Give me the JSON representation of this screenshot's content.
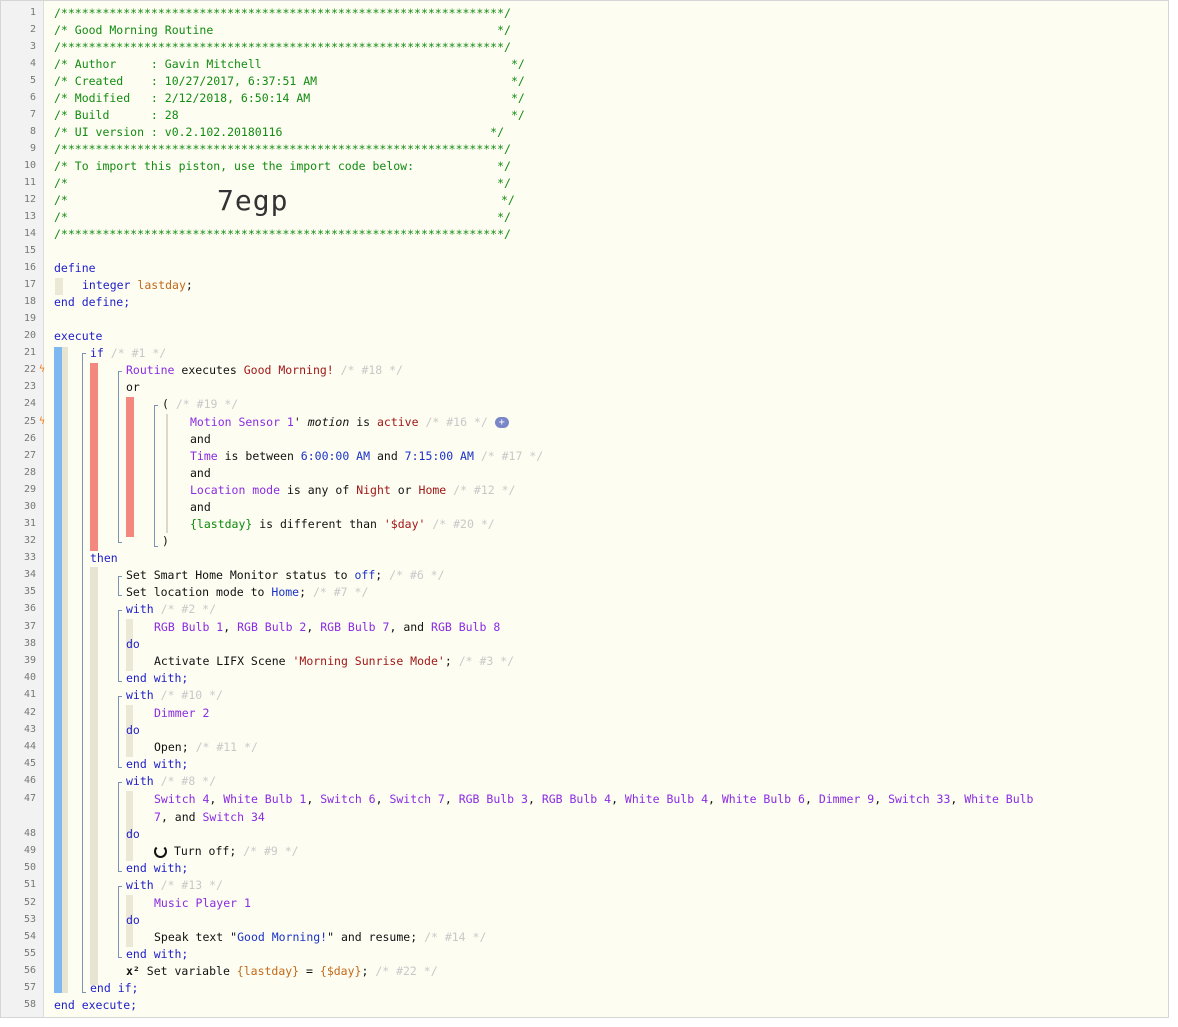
{
  "header": {
    "stars": "/****************************************************************/",
    "title": "/* Good Morning Routine                                         */",
    "author": "/* Author     : Gavin Mitchell                                    */",
    "created": "/* Created    : 10/27/2017, 6:37:51 AM                            */",
    "modified": "/* Modified   : 2/12/2018, 6:50:14 AM                             */",
    "build": "/* Build      : 28                                                */",
    "ui_version": "/* UI version : v0.2.102.20180116                              */",
    "import_line": "/* To import this piston, use the import code below:            */",
    "blank_a": "/*                                                              */",
    "code_prefix": "/*",
    "code_suffix": "*/",
    "import_code": "7egp"
  },
  "lines": {
    "l16": "define",
    "l17_type": "integer",
    "l17_name": "lastday",
    "l18": "end define;",
    "l20": "execute",
    "l21_if": "if",
    "l21_c": "/* #1 */",
    "l22_a": "Routine",
    "l22_b": " executes ",
    "l22_c": "Good Morning!",
    "l22_d": "/* #18 */",
    "l23": "or",
    "l24_p": "(",
    "l24_c": "/* #19 */",
    "l25_dev": "Motion Sensor 1",
    "l25_q": "'",
    "l25_attr": "motion",
    "l25_is": " is ",
    "l25_val": "active",
    "l25_c": "/* #16 */",
    "l26": "and",
    "l27_a": "Time",
    "l27_b": " is between ",
    "l27_c": "6:00:00 AM",
    "l27_d": " and ",
    "l27_e": "7:15:00 AM",
    "l27_f": "/* #17 */",
    "l28": "and",
    "l29_a": "Location mode",
    "l29_b": " is any of ",
    "l29_c": "Night",
    "l29_d": " or ",
    "l29_e": "Home",
    "l29_f": "/* #12 */",
    "l30": "and",
    "l31_a": "{lastday}",
    "l31_b": " is different than ",
    "l31_c": "'$day'",
    "l31_d": "/* #20 */",
    "l32": ")",
    "l33": "then",
    "l34_a": "Set Smart Home Monitor status to ",
    "l34_b": "off",
    "l34_c": ";",
    "l34_d": "/* #6 */",
    "l35_a": "Set location mode to ",
    "l35_b": "Home",
    "l35_c": ";",
    "l35_d": "/* #7 */",
    "with": "with",
    "do": "do",
    "end_with": "end with;",
    "l36_c": "/* #2 */",
    "l37_d1": "RGB Bulb 1",
    "l37_d2": "RGB Bulb 2",
    "l37_d3": "RGB Bulb 7",
    "l37_d4": "RGB Bulb 8",
    "comma": ", ",
    "and_sep": ", and ",
    "l39_a": "Activate LIFX Scene ",
    "l39_b": "'Morning Sunrise Mode'",
    "l39_c": ";",
    "l39_d": "/* #3 */",
    "l41_c": "/* #10 */",
    "l42": "Dimmer 2",
    "l44_a": "Open;",
    "l44_b": "/* #11 */",
    "l46_c": "/* #8 */",
    "l47_devices": [
      "Switch 4",
      "White Bulb 1",
      "Switch 6",
      "Switch 7",
      "RGB Bulb 3",
      "RGB Bulb 4",
      "White Bulb 4",
      "White Bulb 6",
      "Dimmer 9",
      "Switch 33"
    ],
    "l47_wrap1": "White Bulb",
    "l47_wrap2": "7",
    "l47_last": "Switch 34",
    "l49_a": "Turn off;",
    "l49_b": "/* #9 */",
    "l51_c": "/* #13 */",
    "l52": "Music Player 1",
    "l54_a": "Speak text \"",
    "l54_b": "Good Morning!",
    "l54_c": "\" and resume;",
    "l54_d": "/* #14 */",
    "l56_x": "x²",
    "l56_a": " Set variable ",
    "l56_b": "{lastday}",
    "l56_c": " = ",
    "l56_d": "{$day}",
    "l56_e": ";",
    "l56_f": "/* #22 */",
    "l57": "end if;",
    "l58": "end execute;"
  },
  "colors": {
    "background": "#fefdf2",
    "gutter": "#f2f2f2",
    "comment_header": "#128c12",
    "keyword": "#2020c8",
    "device": "#8a2be2",
    "value": "#a01818",
    "bar_blue": "#7db8f0",
    "bar_red": "#f3887e"
  },
  "icons": {
    "bolt": "lightning-bolt-icon",
    "plus": "add-condition-icon",
    "ring": "turn-off-icon"
  }
}
